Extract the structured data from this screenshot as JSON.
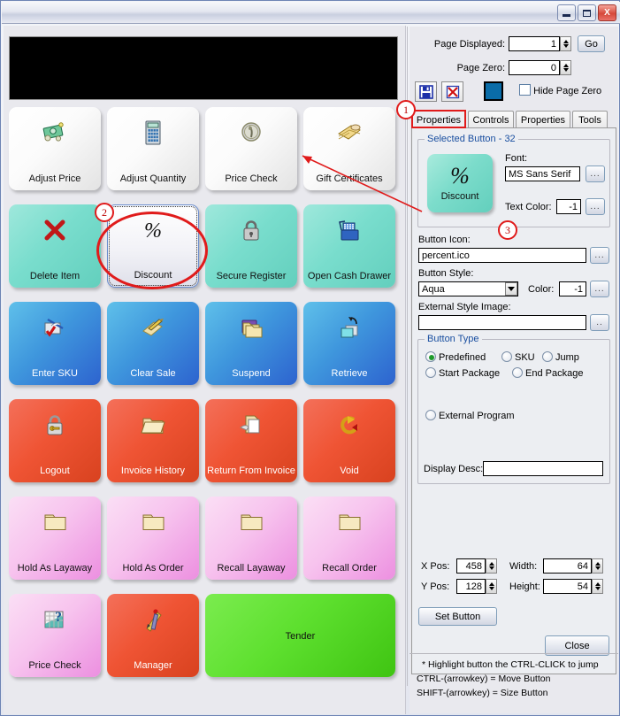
{
  "window": {
    "title": "",
    "minimize_label": "Minimize",
    "maximize_label": "Maximize",
    "close_label": "X"
  },
  "header": {
    "page_displayed_label": "Page Displayed:",
    "page_displayed_value": "1",
    "go_label": "Go",
    "page_zero_label": "Page Zero:",
    "page_zero_value": "0",
    "save_icon": "floppy-save-icon",
    "delete_icon": "red-x-delete-icon",
    "color_swatch": "#0a6ca8",
    "hide_page_zero_label": "Hide Page Zero",
    "hide_page_zero_checked": false
  },
  "tabs": [
    {
      "label": "Properties",
      "active": true
    },
    {
      "label": "Controls",
      "active": false
    },
    {
      "label": "Properties",
      "active": false
    },
    {
      "label": "Tools",
      "active": false
    }
  ],
  "selected_button_group": {
    "title": "Selected Button - 32",
    "preview_caption": "Discount",
    "preview_symbol": "%",
    "font_label": "Font:",
    "font_value": "MS Sans Serif",
    "font_browse": "...",
    "text_color_label": "Text Color:",
    "text_color_value": "-1",
    "text_color_browse": "..."
  },
  "button_icon": {
    "label": "Button Icon:",
    "value": "percent.ico",
    "browse": "..."
  },
  "button_style": {
    "label": "Button Style:",
    "value": "Aqua",
    "options": [
      "Aqua"
    ],
    "color_label": "Color:",
    "color_value": "-1",
    "color_browse": "..."
  },
  "external_style_image": {
    "label": "External Style Image:",
    "value": "",
    "browse": ".."
  },
  "button_type": {
    "title": "Button Type",
    "options": [
      {
        "label": "Predefined",
        "selected": true
      },
      {
        "label": "SKU",
        "selected": false
      },
      {
        "label": "Jump",
        "selected": false
      },
      {
        "label": "Start Package",
        "selected": false
      },
      {
        "label": "End Package",
        "selected": false
      },
      {
        "label": "External Program",
        "selected": false
      }
    ],
    "display_desc_label": "Display Desc:",
    "display_desc_value": ""
  },
  "geometry": {
    "x_pos_label": "X Pos:",
    "x_pos_value": "458",
    "y_pos_label": "Y Pos:",
    "y_pos_value": "128",
    "width_label": "Width:",
    "width_value": "64",
    "height_label": "Height:",
    "height_value": "54"
  },
  "actions": {
    "set_button_label": "Set Button",
    "close_label": "Close"
  },
  "hints": [
    "* Highlight button the CTRL-CLICK to jump",
    "CTRL-(arrowkey) = Move Button",
    "SHIFT-(arrowkey) = Size Button"
  ],
  "callouts": [
    {
      "number": "1"
    },
    {
      "number": "2"
    },
    {
      "number": "3"
    }
  ],
  "pos_grid": {
    "rows": [
      [
        {
          "label": "Adjust Price",
          "style": "white",
          "icon": "money-icon"
        },
        {
          "label": "Adjust Quantity",
          "style": "white",
          "icon": "calculator-icon"
        },
        {
          "label": "Price Check",
          "style": "white",
          "icon": "coin-icon"
        },
        {
          "label": "Gift Certificates",
          "style": "white",
          "icon": "gift-envelope-icon"
        }
      ],
      [
        {
          "label": "Delete Item",
          "style": "aqua",
          "icon": "red-x-icon"
        },
        {
          "label": "Discount",
          "style": "selected",
          "icon": "percent-icon",
          "selected": true
        },
        {
          "label": "Secure Register",
          "style": "aqua",
          "icon": "padlock-icon"
        },
        {
          "label": "Open Cash Drawer",
          "style": "aqua",
          "icon": "cash-register-icon"
        }
      ],
      [
        {
          "label": "Enter SKU",
          "style": "blue",
          "icon": "write-check-icon"
        },
        {
          "label": "Clear Sale",
          "style": "blue",
          "icon": "pencil-note-icon"
        },
        {
          "label": "Suspend",
          "style": "blue",
          "icon": "folders-icon"
        },
        {
          "label": "Retrieve",
          "style": "blue",
          "icon": "retrieve-windows-icon"
        }
      ],
      [
        {
          "label": "Logout",
          "style": "red",
          "icon": "lock-key-icon"
        },
        {
          "label": "Invoice History",
          "style": "red",
          "icon": "open-folder-icon"
        },
        {
          "label": "Return From Invoice",
          "style": "red",
          "icon": "return-document-icon"
        },
        {
          "label": "Void",
          "style": "red",
          "icon": "undo-arrow-icon"
        }
      ],
      [
        {
          "label": "Hold As Layaway",
          "style": "pink",
          "icon": "folder-icon"
        },
        {
          "label": "Hold As Order",
          "style": "pink",
          "icon": "folder-icon"
        },
        {
          "label": "Recall Layaway",
          "style": "pink",
          "icon": "folder-icon"
        },
        {
          "label": "Recall Order",
          "style": "pink",
          "icon": "folder-icon"
        }
      ],
      [
        {
          "label": "Price Check",
          "style": "pink",
          "icon": "question-chart-icon"
        },
        {
          "label": "Manager",
          "style": "red",
          "icon": "pencil-person-icon"
        },
        {
          "label": "Tender",
          "style": "green",
          "icon": "",
          "wide": true
        }
      ]
    ]
  }
}
